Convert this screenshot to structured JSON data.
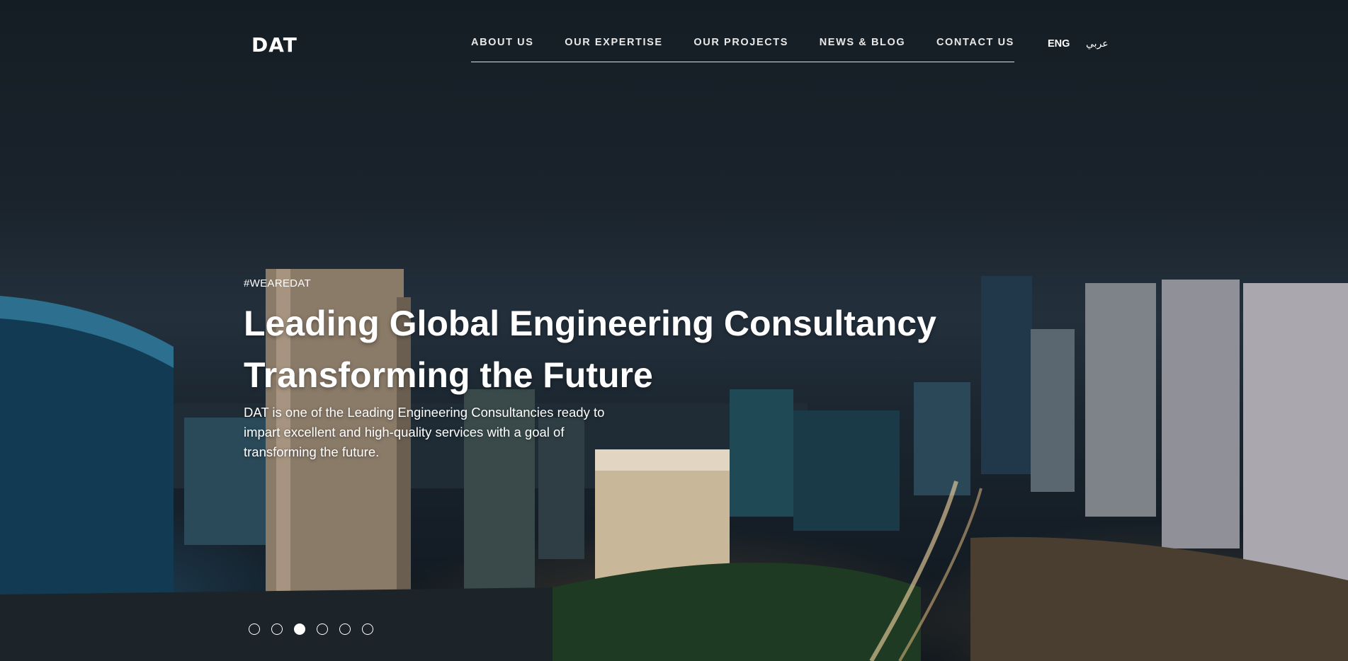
{
  "header": {
    "logo": "DAT",
    "nav": [
      "ABOUT US",
      "OUR EXPERTISE",
      "OUR PROJECTS",
      "NEWS & BLOG",
      "CONTACT US"
    ],
    "lang_en": "ENG",
    "lang_ar": "عربي"
  },
  "hero": {
    "tag": "#WEAREDAT",
    "headline_line1": "Leading Global Engineering Consultancy",
    "headline_line2": "Transforming the Future",
    "description": "DAT is one of the Leading Engineering Consultancies ready to impart excellent and high-quality services with a goal of transforming the future."
  },
  "slider": {
    "slide_count": 6,
    "active_index": 2
  }
}
